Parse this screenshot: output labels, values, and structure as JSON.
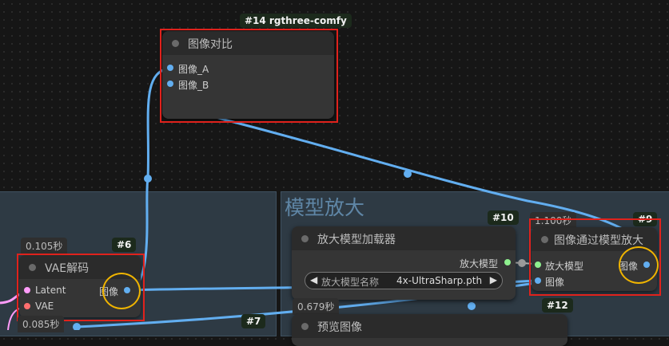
{
  "nodes": {
    "compare": {
      "badge": "#14 rgthree-comfy",
      "title": "图像对比",
      "input_a": "图像_A",
      "input_b": "图像_B"
    },
    "vae": {
      "badge": "#6",
      "timing": "0.105秒",
      "title": "VAE解码",
      "input_latent": "Latent",
      "input_vae": "VAE",
      "output": "图像"
    },
    "loader": {
      "badge": "#10",
      "title": "放大模型加载器",
      "output": "放大模型",
      "widget_label": "放大模型名称",
      "widget_value": "4x-UltraSharp.pth",
      "timing": "0.679秒"
    },
    "upscale": {
      "badge": "#9",
      "timing": "1.100秒",
      "title": "图像通过模型放大",
      "input_model": "放大模型",
      "input_image": "图像",
      "output": "图像"
    },
    "preview": {
      "badge": "#12",
      "title": "预览图像"
    },
    "node7": {
      "badge": "#7",
      "timing": "0.085秒"
    }
  },
  "group": {
    "title": "模型放大"
  },
  "colors": {
    "image_wire": "#62aef0",
    "latent": "#ff9cf9",
    "vae": "#ff6e6e",
    "upscale_model": "#8ef08e",
    "highlight_red": "#e0221c",
    "highlight_yellow": "#f0b400"
  }
}
